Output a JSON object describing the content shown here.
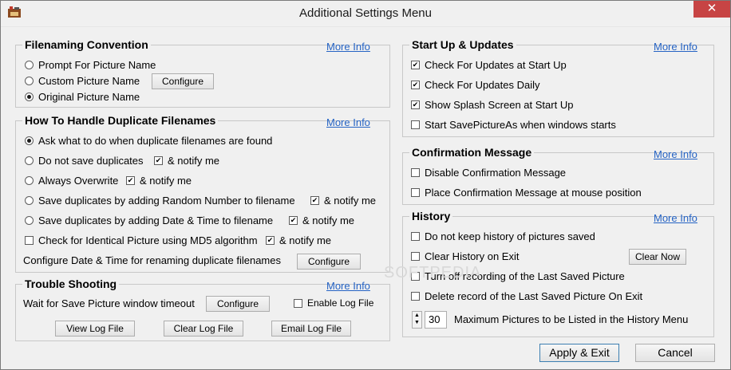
{
  "window": {
    "title": "Additional Settings Menu",
    "close_glyph": "✕"
  },
  "filenaming": {
    "title": "Filenaming Convention",
    "more_info": "More Info",
    "options": [
      {
        "label": "Prompt For Picture Name",
        "selected": false
      },
      {
        "label": "Custom Picture Name",
        "selected": false
      },
      {
        "label": "Original Picture Name",
        "selected": true
      }
    ],
    "configure": "Configure"
  },
  "duplicates": {
    "title": "How To Handle Duplicate Filenames",
    "more_info": "More Info",
    "options": [
      {
        "label": "Ask what to do when duplicate filenames are found",
        "selected": true
      },
      {
        "label": "Do not save duplicates",
        "selected": false,
        "notify": "& notify me",
        "notify_checked": true
      },
      {
        "label": "Always Overwrite",
        "selected": false,
        "notify": "& notify me",
        "notify_checked": true
      },
      {
        "label": "Save duplicates by adding Random Number to filename",
        "selected": false,
        "notify": "& notify me",
        "notify_checked": true
      },
      {
        "label": "Save duplicates by adding Date & Time to filename",
        "selected": false,
        "notify": "& notify me",
        "notify_checked": true
      }
    ],
    "md5": {
      "label": "Check for Identical Picture using MD5 algorithm",
      "checked": false,
      "notify": "& notify me",
      "notify_checked": true
    },
    "date_time_label": "Configure Date & Time for renaming duplicate filenames",
    "configure": "Configure"
  },
  "trouble": {
    "title": "Trouble Shooting",
    "more_info": "More Info",
    "timeout_label": "Wait for Save Picture window timeout",
    "configure": "Configure",
    "enable_log": "Enable Log File",
    "enable_log_checked": false,
    "view_log": "View Log File",
    "clear_log": "Clear Log File",
    "email_log": "Email Log File"
  },
  "startup": {
    "title": "Start Up & Updates",
    "more_info": "More Info",
    "items": [
      {
        "label": "Check For Updates at Start Up",
        "checked": true
      },
      {
        "label": "Check For Updates Daily",
        "checked": true
      },
      {
        "label": "Show Splash Screen at Start Up",
        "checked": true
      },
      {
        "label": "Start SavePictureAs when windows starts",
        "checked": false
      }
    ]
  },
  "confirmation": {
    "title": "Confirmation Message",
    "more_info": "More Info",
    "items": [
      {
        "label": "Disable Confirmation Message",
        "checked": false
      },
      {
        "label": "Place Confirmation Message at mouse position",
        "checked": false
      }
    ]
  },
  "history": {
    "title": "History",
    "more_info": "More Info",
    "items": [
      {
        "label": "Do not keep history of pictures saved",
        "checked": false
      },
      {
        "label": "Clear History on Exit",
        "checked": false
      },
      {
        "label": "Turn off recording of the Last Saved Picture",
        "checked": false
      },
      {
        "label": "Delete record of the Last Saved Picture On Exit",
        "checked": false
      }
    ],
    "clear_now": "Clear Now",
    "max_value": "30",
    "max_label": "Maximum Pictures to be Listed in the History Menu"
  },
  "footer": {
    "apply": "Apply & Exit",
    "cancel": "Cancel"
  },
  "watermark": "SOFTPEDIA"
}
